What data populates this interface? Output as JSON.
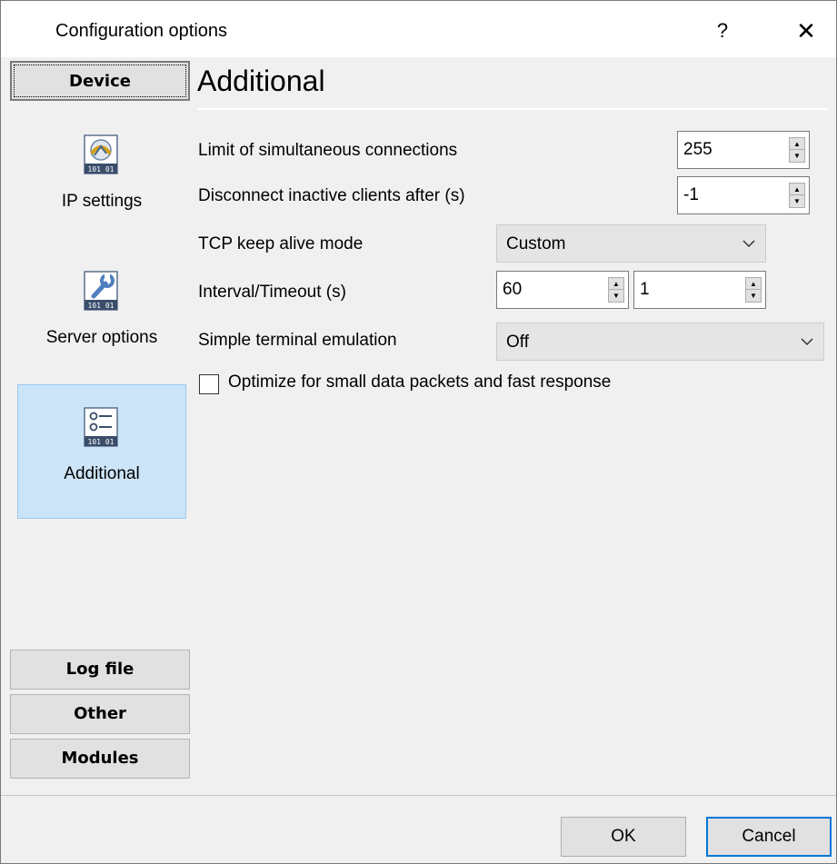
{
  "window": {
    "title": "Configuration options",
    "help_label": "?",
    "close_label": "✕"
  },
  "sidebar": {
    "device_label": "Device",
    "items": [
      {
        "label": "IP settings",
        "icon": "network-ip-icon"
      },
      {
        "label": "Server options",
        "icon": "wrench-icon"
      },
      {
        "label": "Additional",
        "icon": "options-list-icon",
        "selected": true
      }
    ],
    "log_file_label": "Log file",
    "other_label": "Other",
    "modules_label": "Modules"
  },
  "main": {
    "title": "Additional",
    "limit_connections_label": "Limit of simultaneous connections",
    "limit_connections_value": "255",
    "disconnect_label": "Disconnect inactive clients after (s)",
    "disconnect_value": "-1",
    "keepalive_label": "TCP keep alive mode",
    "keepalive_value": "Custom",
    "interval_label": "Interval/Timeout (s)",
    "interval_value": "60",
    "timeout_value": "1",
    "terminal_label": "Simple terminal emulation",
    "terminal_value": "Off",
    "optimize_label": "Optimize for small data packets and fast response",
    "optimize_checked": false
  },
  "buttons": {
    "ok_label": "OK",
    "cancel_label": "Cancel"
  },
  "colors": {
    "selection_bg": "#cce4f7",
    "selection_border": "#99c9ef",
    "default_button_border": "#0078d7"
  }
}
